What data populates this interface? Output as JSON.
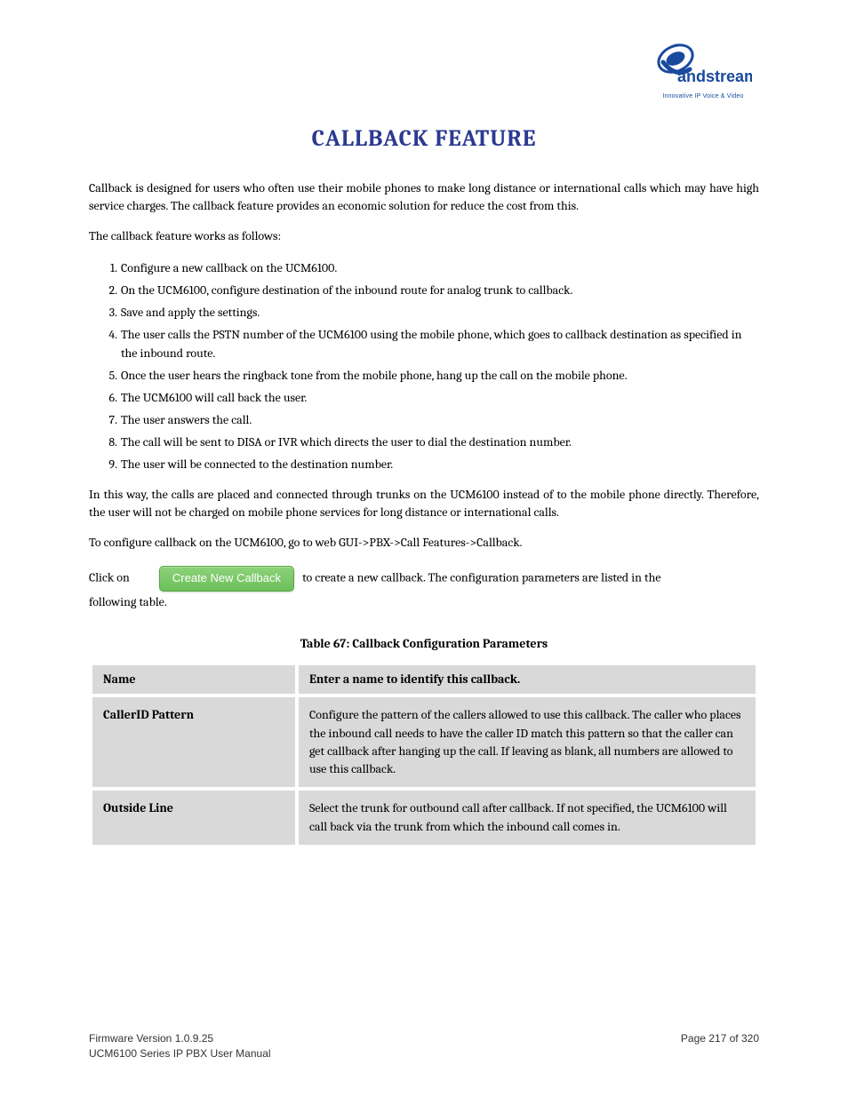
{
  "logo": {
    "brand": "Grandstream",
    "tagline": "Innovative IP Voice & Video"
  },
  "title": "CALLBACK FEATURE",
  "intro": "Callback is designed for users who often use their mobile phones to make long distance or international calls which may have high service charges. The callback feature provides an economic solution for reduce the cost from this.",
  "how_it_works": "The callback feature works as follows:",
  "steps": [
    "Configure a new callback on the UCM6100.",
    "On the UCM6100, configure destination of the inbound route for analog trunk to callback.",
    "Save and apply the settings.",
    "The user calls the PSTN number of the UCM6100 using the mobile phone, which goes to callback destination as specified in the inbound route.",
    "Once the user hears the ringback tone from the mobile phone, hang up the call on the mobile phone.",
    "The UCM6100 will call back the user.",
    "The user answers the call.",
    "The call will be sent to DISA or IVR which directs the user to dial the destination number.",
    "The user will be connected to the destination number."
  ],
  "note": "In this way, the calls are placed and connected through trunks on the UCM6100 instead of to the mobile phone directly. Therefore, the user will not be charged on mobile phone services for long distance or international calls.",
  "section_lead": "To configure callback on the UCM6100, go to web GUI->PBX->Call Features->Callback.",
  "click_prefix": "Click on",
  "button_label": "Create New Callback",
  "click_suffix": "to create a new callback. The configuration parameters are listed in the",
  "click_suffix2": "following table.",
  "table_caption": "Table 67: Callback Configuration Parameters",
  "table": {
    "header_left": "Name",
    "header_right": "Enter a name to identify this callback.",
    "rows": [
      {
        "label": "CallerID Pattern",
        "desc": "Configure the pattern of the callers allowed to use this callback. The caller who places the inbound call needs to have the caller ID match this pattern so that the caller can get callback after hanging up the call. If leaving as blank, all numbers are allowed to use this callback."
      },
      {
        "label": "Outside Line",
        "desc": "Select the trunk for outbound call after callback. If not specified, the UCM6100 will call back via the trunk from which the inbound call comes in."
      }
    ]
  },
  "footer": {
    "firmware": "Firmware Version 1.0.9.25",
    "manual": "UCM6100 Series IP PBX User Manual",
    "page_label": "Page",
    "page_num": "217 of 320"
  }
}
